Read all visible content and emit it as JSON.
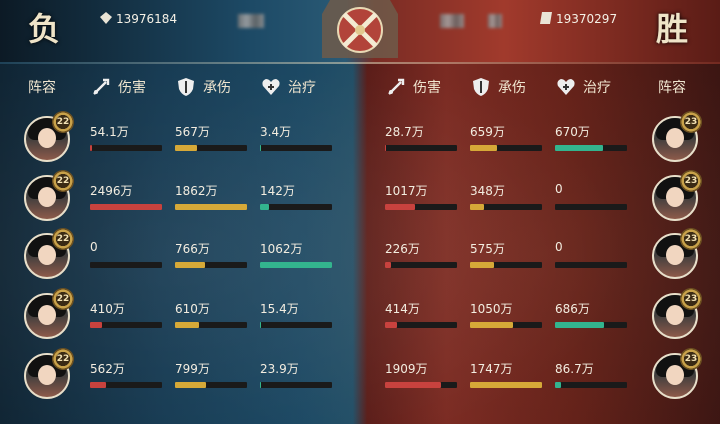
{
  "header": {
    "left_result": "负",
    "right_result": "胜",
    "left_score": "13976184",
    "right_score": "19370297"
  },
  "columns": {
    "lineup": "阵容",
    "damage": "伤害",
    "tank": "承伤",
    "heal": "治疗"
  },
  "colors": {
    "damage": "#c8423e",
    "tank": "#d6a938",
    "heal": "#33b48e"
  },
  "left_team": [
    {
      "level": "22",
      "damage": "54.1万",
      "damage_pct": 0.03,
      "tank": "567万",
      "tank_pct": 0.3,
      "heal": "3.4万",
      "heal_pct": 0.01
    },
    {
      "level": "22",
      "damage": "2496万",
      "damage_pct": 1.0,
      "tank": "1862万",
      "tank_pct": 1.0,
      "heal": "142万",
      "heal_pct": 0.13
    },
    {
      "level": "22",
      "damage": "0",
      "damage_pct": 0.0,
      "tank": "766万",
      "tank_pct": 0.41,
      "heal": "1062万",
      "heal_pct": 1.0
    },
    {
      "level": "22",
      "damage": "410万",
      "damage_pct": 0.16,
      "tank": "610万",
      "tank_pct": 0.33,
      "heal": "15.4万",
      "heal_pct": 0.02
    },
    {
      "level": "22",
      "damage": "562万",
      "damage_pct": 0.22,
      "tank": "799万",
      "tank_pct": 0.43,
      "heal": "23.9万",
      "heal_pct": 0.02
    }
  ],
  "right_team": [
    {
      "level": "23",
      "damage": "28.7万",
      "damage_pct": 0.02,
      "tank": "659万",
      "tank_pct": 0.38,
      "heal": "670万",
      "heal_pct": 0.66
    },
    {
      "level": "23",
      "damage": "1017万",
      "damage_pct": 0.42,
      "tank": "348万",
      "tank_pct": 0.2,
      "heal": "0",
      "heal_pct": 0.0
    },
    {
      "level": "23",
      "damage": "226万",
      "damage_pct": 0.09,
      "tank": "575万",
      "tank_pct": 0.33,
      "heal": "0",
      "heal_pct": 0.0
    },
    {
      "level": "23",
      "damage": "414万",
      "damage_pct": 0.17,
      "tank": "1050万",
      "tank_pct": 0.6,
      "heal": "686万",
      "heal_pct": 0.68
    },
    {
      "level": "23",
      "damage": "1909万",
      "damage_pct": 0.78,
      "tank": "1747万",
      "tank_pct": 1.0,
      "heal": "86.7万",
      "heal_pct": 0.09
    }
  ]
}
